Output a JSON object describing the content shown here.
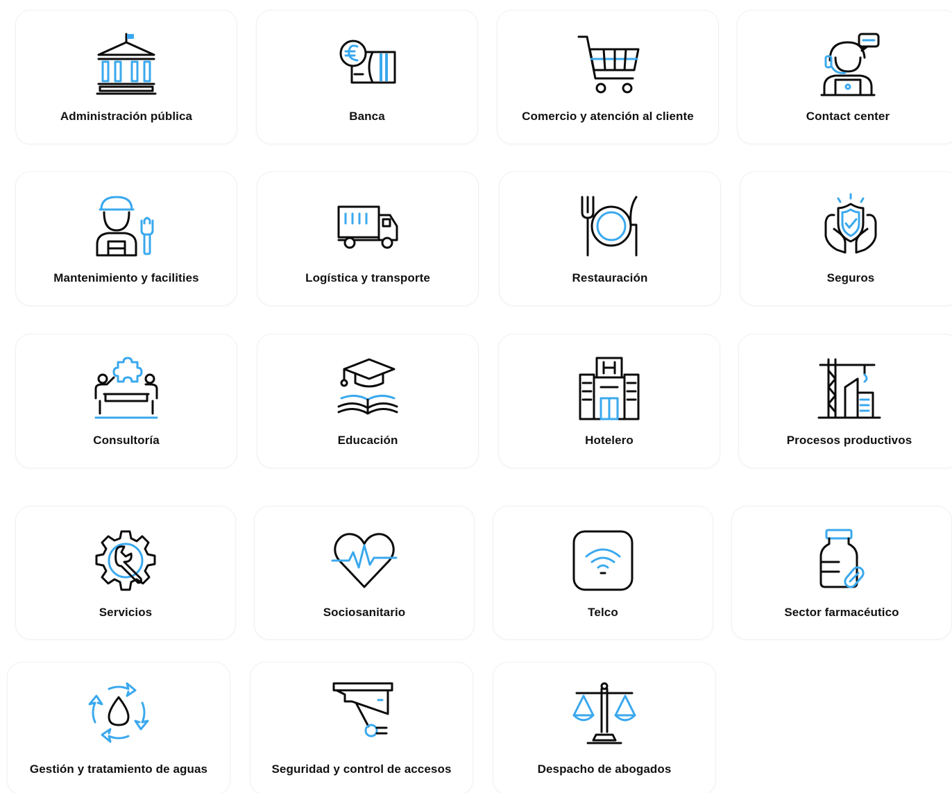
{
  "accent_color": "#3aa8ee",
  "sectors": [
    {
      "label": "Administración pública",
      "icon": "government-building-icon"
    },
    {
      "label": "Banca",
      "icon": "euro-coin-banknote-icon"
    },
    {
      "label": "Comercio y atención al cliente",
      "icon": "shopping-cart-icon"
    },
    {
      "label": "Contact center",
      "icon": "headset-agent-icon"
    },
    {
      "label": "Mantenimiento y facilities",
      "icon": "maintenance-worker-wrench-icon"
    },
    {
      "label": "Logística y transporte",
      "icon": "delivery-truck-icon"
    },
    {
      "label": "Restauración",
      "icon": "plate-fork-knife-icon"
    },
    {
      "label": "Seguros",
      "icon": "shield-hands-icon"
    },
    {
      "label": "Consultoría",
      "icon": "consulting-meeting-puzzle-icon"
    },
    {
      "label": "Educación",
      "icon": "graduation-cap-book-icon"
    },
    {
      "label": "Hotelero",
      "icon": "hotel-building-icon"
    },
    {
      "label": "Procesos productivos",
      "icon": "construction-crane-icon"
    },
    {
      "label": "Servicios",
      "icon": "gear-wrench-icon"
    },
    {
      "label": "Sociosanitario",
      "icon": "heart-pulse-icon"
    },
    {
      "label": "Telco",
      "icon": "wifi-icon"
    },
    {
      "label": "Sector farmacéutico",
      "icon": "medicine-bottle-pill-icon"
    },
    {
      "label": "Gestión y tratamiento de aguas",
      "icon": "water-drop-recycle-icon"
    },
    {
      "label": "Seguridad y control de accesos",
      "icon": "security-camera-icon"
    },
    {
      "label": "Despacho de abogados",
      "icon": "justice-scale-icon"
    }
  ]
}
